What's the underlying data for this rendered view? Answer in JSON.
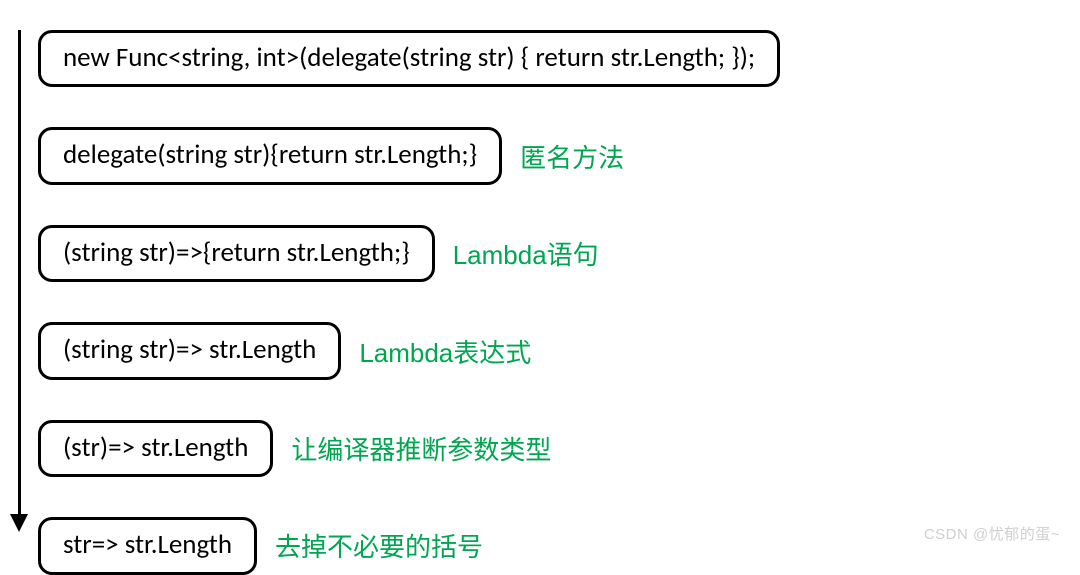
{
  "rows": [
    {
      "code": "new Func<string, int>(delegate(string str) { return str.Length; });",
      "label": ""
    },
    {
      "code": "delegate(string str){return str.Length;}",
      "label": "匿名方法"
    },
    {
      "code": "(string str)=>{return str.Length;}",
      "label": "Lambda语句"
    },
    {
      "code": "(string str)=> str.Length",
      "label": "Lambda表达式"
    },
    {
      "code": "(str)=> str.Length",
      "label": "让编译器推断参数类型"
    },
    {
      "code": "str=> str.Length",
      "label": "去掉不必要的括号"
    }
  ],
  "watermark": "CSDN @忧郁的蛋~"
}
